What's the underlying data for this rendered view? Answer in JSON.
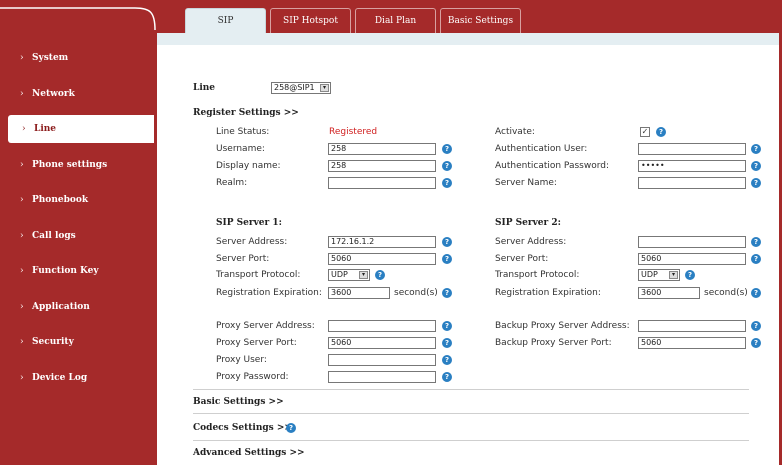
{
  "sidebar": {
    "items": [
      {
        "label": "System"
      },
      {
        "label": "Network"
      },
      {
        "label": "Line"
      },
      {
        "label": "Phone settings"
      },
      {
        "label": "Phonebook"
      },
      {
        "label": "Call logs"
      },
      {
        "label": "Function Key"
      },
      {
        "label": "Application"
      },
      {
        "label": "Security"
      },
      {
        "label": "Device Log"
      }
    ],
    "active": "Line",
    "chevron": "›"
  },
  "tabs": [
    {
      "label": "SIP"
    },
    {
      "label": "SIP Hotspot"
    },
    {
      "label": "Dial Plan"
    },
    {
      "label": "Basic Settings"
    }
  ],
  "line": {
    "label": "Line",
    "value": "258@SIP1"
  },
  "register": {
    "heading": "Register Settings >>",
    "line_status_label": "Line Status:",
    "line_status_value": "Registered",
    "username_label": "Username:",
    "username_value": "258",
    "display_name_label": "Display name:",
    "display_name_value": "258",
    "realm_label": "Realm:",
    "realm_value": "",
    "activate_label": "Activate:",
    "activate_mark": "✓",
    "auth_user_label": "Authentication User:",
    "auth_user_value": "",
    "auth_password_label": "Authentication Password:",
    "auth_password_value": "•••••",
    "server_name_label": "Server Name:",
    "server_name_value": ""
  },
  "sip1": {
    "heading": "SIP Server 1:",
    "address_label": "Server Address:",
    "address_value": "172.16.1.2",
    "port_label": "Server Port:",
    "port_value": "5060",
    "transport_label": "Transport Protocol:",
    "transport_value": "UDP",
    "expiration_label": "Registration Expiration:",
    "expiration_value": "3600",
    "expiration_unit": "second(s)"
  },
  "sip2": {
    "heading": "SIP Server 2:",
    "address_label": "Server Address:",
    "address_value": "",
    "port_label": "Server Port:",
    "port_value": "5060",
    "transport_label": "Transport Protocol:",
    "transport_value": "UDP",
    "expiration_label": "Registration Expiration:",
    "expiration_value": "3600",
    "expiration_unit": "second(s)"
  },
  "proxy": {
    "address_label": "Proxy Server Address:",
    "address_value": "",
    "port_label": "Proxy Server Port:",
    "port_value": "5060",
    "user_label": "Proxy User:",
    "user_value": "",
    "password_label": "Proxy Password:",
    "password_value": "",
    "backup_address_label": "Backup Proxy Server Address:",
    "backup_address_value": "",
    "backup_port_label": "Backup Proxy Server Port:",
    "backup_port_value": "5060"
  },
  "sections": {
    "basic": "Basic Settings >>",
    "codecs": "Codecs Settings >>",
    "advanced": "Advanced Settings >>"
  },
  "icons": {
    "help": "?",
    "dropdown": "▾"
  },
  "colors": {
    "brand": "#a52a2a",
    "help": "#2a7fc2",
    "status": "#d02020"
  }
}
